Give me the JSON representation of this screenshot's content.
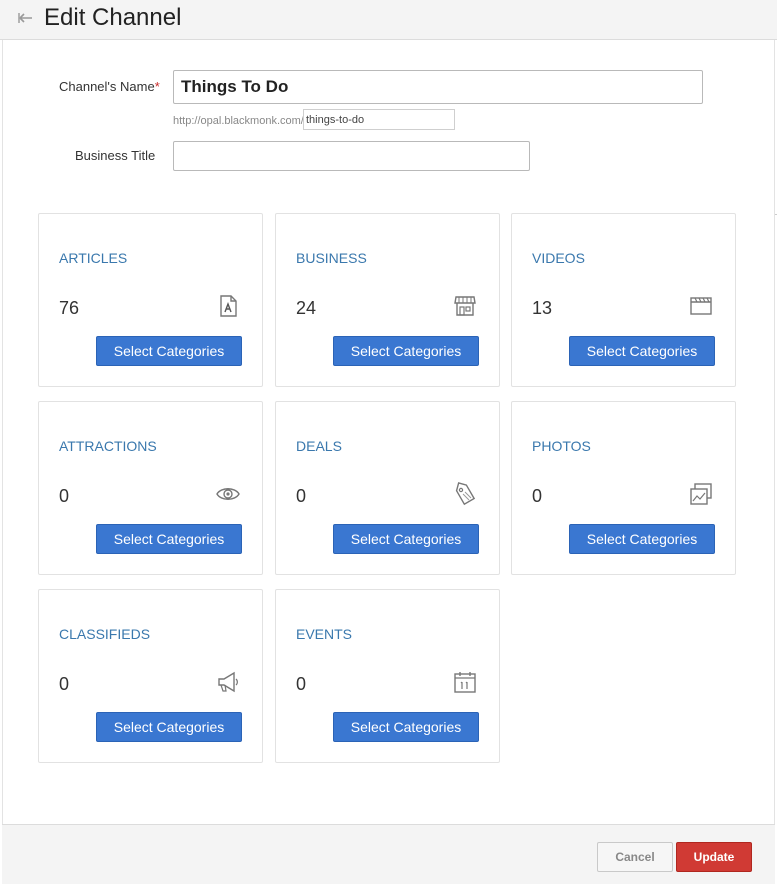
{
  "header": {
    "title": "Edit Channel",
    "back_icon": "back-arrow-icon"
  },
  "form": {
    "channel_name_label": "Channel's Name",
    "required_mark": "*",
    "channel_name_value": "Things To Do",
    "url_prefix": "http://opal.blackmonk.com/",
    "slug_value": "things-to-do",
    "business_title_label": "Business Title",
    "business_title_value": ""
  },
  "cards": [
    {
      "title": "ARTICLES",
      "count": "76",
      "icon": "article-icon",
      "button": "Select Categories"
    },
    {
      "title": "BUSINESS",
      "count": "24",
      "icon": "storefront-icon",
      "button": "Select Categories"
    },
    {
      "title": "VIDEOS",
      "count": "13",
      "icon": "clapperboard-icon",
      "button": "Select Categories"
    },
    {
      "title": "ATTRACTIONS",
      "count": "0",
      "icon": "eye-icon",
      "button": "Select Categories"
    },
    {
      "title": "DEALS",
      "count": "0",
      "icon": "tag-icon",
      "button": "Select Categories"
    },
    {
      "title": "PHOTOS",
      "count": "0",
      "icon": "photos-icon",
      "button": "Select Categories"
    },
    {
      "title": "CLASSIFIEDS",
      "count": "0",
      "icon": "megaphone-icon",
      "button": "Select Categories"
    },
    {
      "title": "EVENTS",
      "count": "0",
      "icon": "calendar-icon",
      "button": "Select Categories"
    }
  ],
  "footer": {
    "cancel_label": "Cancel",
    "update_label": "Update"
  },
  "colors": {
    "accent": "#3a77d1",
    "card_title": "#3a78ad",
    "update": "#d03a34",
    "required": "#c82a2a"
  }
}
